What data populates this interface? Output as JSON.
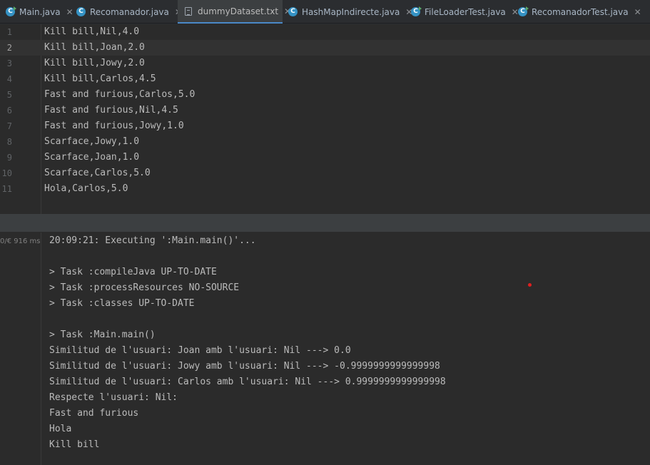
{
  "tabs": [
    {
      "label": "Main.java",
      "type": "class-run",
      "active": false
    },
    {
      "label": "Recomanador.java",
      "type": "class",
      "active": false
    },
    {
      "label": "dummyDataset.txt",
      "type": "text",
      "active": true
    },
    {
      "label": "HashMapIndirecte.java",
      "type": "class",
      "active": false
    },
    {
      "label": "FileLoaderTest.java",
      "type": "class-run",
      "active": false
    },
    {
      "label": "RecomanadorTest.java",
      "type": "class-run",
      "active": false
    }
  ],
  "close_glyph": "✕",
  "class_icon_letter": "C",
  "editor": {
    "current_line": 2,
    "lines": [
      "Kill bill,Nil,4.0",
      "Kill bill,Joan,2.0",
      "Kill bill,Jowy,2.0",
      "Kill bill,Carlos,4.5",
      "Fast and furious,Carlos,5.0",
      "Fast and furious,Nil,4.5",
      "Fast and furious,Jowy,1.0",
      "Scarface,Jowy,1.0",
      "Scarface,Joan,1.0",
      "Scarface,Carlos,5.0",
      "Hola,Carlos,5.0"
    ],
    "line_numbers": [
      "1",
      "2",
      "3",
      "4",
      "5",
      "6",
      "7",
      "8",
      "9",
      "10",
      "11"
    ]
  },
  "console": {
    "meta": "0/€ 916 ms",
    "lines": [
      "20:09:21: Executing ':Main.main()'...",
      "",
      "> Task :compileJava UP-TO-DATE",
      "> Task :processResources NO-SOURCE",
      "> Task :classes UP-TO-DATE",
      "",
      "> Task :Main.main()",
      "Similitud de l'usuari: Joan amb l'usuari: Nil ---> 0.0",
      "Similitud de l'usuari: Jowy amb l'usuari: Nil ---> -0.9999999999999998",
      "Similitud de l'usuari: Carlos amb l'usuari: Nil ---> 0.9999999999999998",
      "Respecte l'usuari: Nil:",
      "Fast and furious",
      "Hola",
      "Kill bill"
    ]
  },
  "colors": {
    "accent": "#4a88c7",
    "class_icon": "#3592c4",
    "text": "#bbbbbb",
    "marker": "#e02020"
  }
}
